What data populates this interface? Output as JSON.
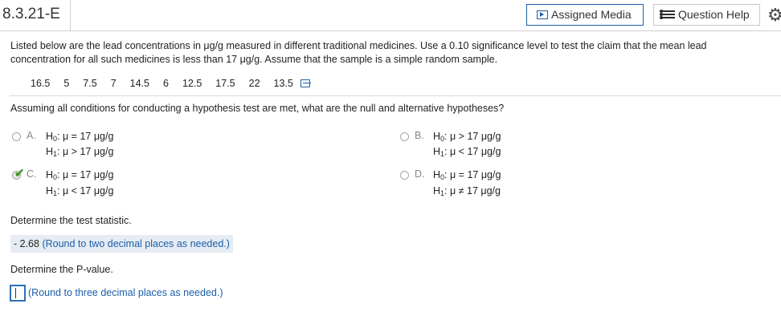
{
  "header": {
    "question_id": "8.3.21-E",
    "assigned_media_label": "Assigned Media",
    "question_help_label": "Question Help"
  },
  "problem": {
    "text_line1": "Listed below are the lead concentrations in μg/g measured in different traditional medicines. Use a 0.10 significance level to test the claim that the mean lead",
    "text_line2": "concentration for all such medicines is less than 17 μg/g. Assume that the sample is a simple random sample.",
    "data_values": [
      "16.5",
      "5",
      "7.5",
      "7",
      "14.5",
      "6",
      "12.5",
      "17.5",
      "22",
      "13.5"
    ]
  },
  "question1": {
    "prompt": "Assuming all conditions for conducting a hypothesis test are met, what are the null and alternative hypotheses?",
    "options": [
      {
        "letter": "A.",
        "h0": ": μ = 17 μg/g",
        "h1": ": μ > 17 μg/g",
        "selected": false
      },
      {
        "letter": "B.",
        "h0": ": μ > 17 μg/g",
        "h1": ": μ < 17 μg/g",
        "selected": false
      },
      {
        "letter": "C.",
        "h0": ": μ = 17 μg/g",
        "h1": ": μ < 17 μg/g",
        "selected": true
      },
      {
        "letter": "D.",
        "h0": ": μ = 17 μg/g",
        "h1": ": μ ≠ 17 μg/g",
        "selected": false
      }
    ]
  },
  "question2": {
    "prompt": "Determine the test statistic.",
    "answer": "- 2.68",
    "hint": "(Round to two decimal places as needed.)"
  },
  "question3": {
    "prompt": "Determine the P-value.",
    "input_value": "",
    "hint": "(Round to three decimal places as needed.)"
  },
  "colors": {
    "accent": "#1c5fa8",
    "correct": "#3f9a2b",
    "answer_bg": "#e6ecf3"
  }
}
